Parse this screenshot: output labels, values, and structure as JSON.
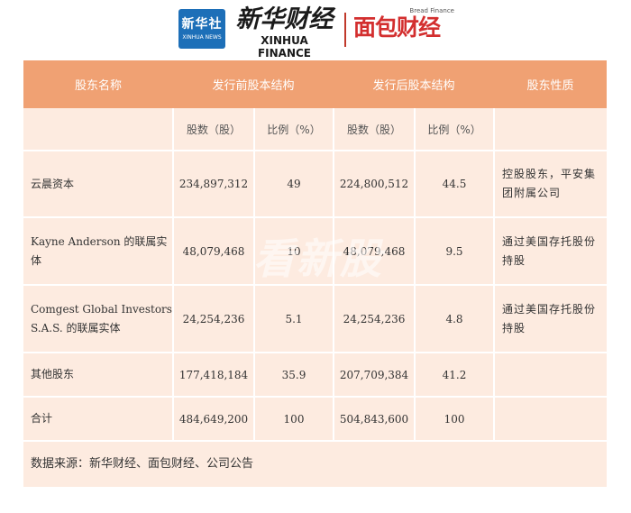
{
  "header": {
    "xinhua_news_cn": "新华社",
    "xinhua_news_en": "XINHUA NEWS",
    "xinhua_finance_cn": "新华财经",
    "xinhua_finance_en": "XINHUA FINANCE",
    "bread_finance_en": "Bread Finance",
    "bread_finance_cn": "面包财经"
  },
  "table": {
    "headers": [
      "股东名称",
      "发行前股本结构",
      "发行后股本结构",
      "股东性质"
    ],
    "subheaders": [
      "股数（股）",
      "比例（%）",
      "股数（股）",
      "比例（%）"
    ],
    "rows": [
      {
        "name": "云晨资本",
        "pre_shares": "234,897,312",
        "pre_ratio": "49",
        "post_shares": "224,800,512",
        "post_ratio": "44.5",
        "nature": "控股股东，平安集团附属公司"
      },
      {
        "name": "Kayne Anderson 的联属实体",
        "pre_shares": "48,079,468",
        "pre_ratio": "10",
        "post_shares": "48,079,468",
        "post_ratio": "9.5",
        "nature": "通过美国存托股份持股"
      },
      {
        "name": "Comgest Global Investors S.A.S. 的联属实体",
        "pre_shares": "24,254,236",
        "pre_ratio": "5.1",
        "post_shares": "24,254,236",
        "post_ratio": "4.8",
        "nature": "通过美国存托股份持股"
      },
      {
        "name": "其他股东",
        "pre_shares": "177,418,184",
        "pre_ratio": "35.9",
        "post_shares": "207,709,384",
        "post_ratio": "41.2",
        "nature": ""
      },
      {
        "name": "合计",
        "pre_shares": "484,649,200",
        "pre_ratio": "100",
        "post_shares": "504,843,600",
        "post_ratio": "100",
        "nature": ""
      }
    ],
    "source": "数据来源：新华财经、面包财经、公司公告"
  },
  "watermark": "看新股",
  "colors": {
    "header_bg": "#f0a173",
    "row_bg": "#fdebe0",
    "brand_red": "#d32f2f",
    "brand_blue": "#1d6fb8"
  }
}
